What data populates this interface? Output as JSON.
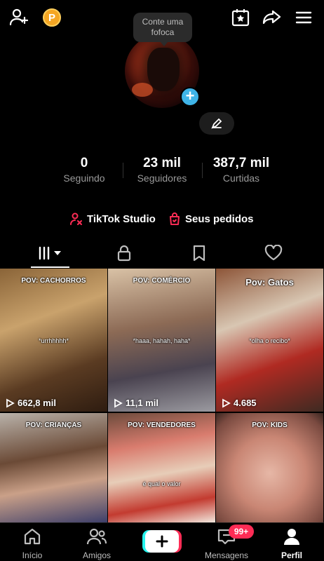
{
  "header": {
    "points_badge": "P",
    "icons": [
      "add-friend-icon",
      "calendar-star-icon",
      "share-icon",
      "menu-icon"
    ]
  },
  "note": {
    "text": "Conte uma fofoca"
  },
  "stats": [
    {
      "value": "0",
      "label": "Seguindo"
    },
    {
      "value": "23 mil",
      "label": "Seguidores"
    },
    {
      "value": "387,7 mil",
      "label": "Curtidas"
    }
  ],
  "actions": {
    "studio": "TikTok Studio",
    "orders": "Seus pedidos"
  },
  "tabs": [
    "videos-grid-icon",
    "lock-icon",
    "bookmark-icon",
    "heart-icon"
  ],
  "videos": [
    {
      "title": "POV: CACHORROS",
      "caption": "*urrhhhhh*",
      "views": "662,8 mil",
      "bg": "#6b4a2a"
    },
    {
      "title": "POV: COMÉRCIO",
      "caption": "*haaa, hahah, haha*",
      "views": "11,1 mil",
      "bg": "#8a6a50"
    },
    {
      "title": "Pov: Gatos",
      "caption": "*olha o recibo*",
      "views": "4.685",
      "bg": "#7a4b35"
    },
    {
      "title": "POV: CRIANÇAS",
      "caption": "",
      "views": "",
      "bg": "#8a7a6a"
    },
    {
      "title": "POV: VENDEDORES",
      "caption": "é qual o valor",
      "views": "",
      "bg": "#7a5a4a"
    },
    {
      "title": "POV: KIDS",
      "caption": "",
      "views": "",
      "bg": "#c8948a"
    }
  ],
  "nav": {
    "home": "Início",
    "friends": "Amigos",
    "messages": "Mensagens",
    "messages_badge": "99+",
    "profile": "Perfil"
  },
  "colors": {
    "accent_red": "#fe2c55",
    "accent_cyan": "#25f4ee",
    "avatar_add": "#3fb4e8",
    "points": "#f5a623"
  }
}
